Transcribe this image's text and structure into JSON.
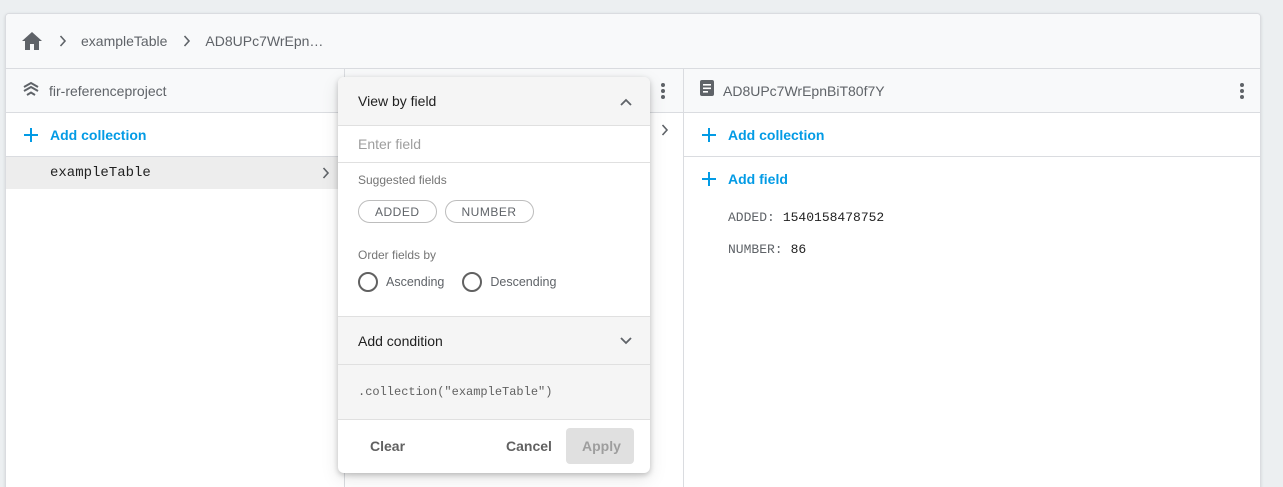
{
  "breadcrumb": {
    "items": [
      "exampleTable",
      "AD8UPc7WrEpn…"
    ]
  },
  "panels": {
    "root": {
      "title": "fir-referenceproject",
      "add_label": "Add collection",
      "items": [
        "exampleTable"
      ]
    },
    "document": {
      "title": "AD8UPc7WrEpnBiT80f7Y",
      "add_collection_label": "Add collection",
      "add_field_label": "Add field",
      "fields": [
        {
          "key": "ADDED:",
          "value": "1540158478752"
        },
        {
          "key": "NUMBER:",
          "value": "86"
        }
      ]
    }
  },
  "filter": {
    "header": "View by field",
    "input_placeholder": "Enter field",
    "suggested_label": "Suggested fields",
    "suggested": [
      "ADDED",
      "NUMBER"
    ],
    "order_label": "Order fields by",
    "order_options": [
      "Ascending",
      "Descending"
    ],
    "condition_label": "Add condition",
    "query": ".collection(\"exampleTable\")",
    "buttons": {
      "clear": "Clear",
      "cancel": "Cancel",
      "apply": "Apply"
    }
  },
  "colors": {
    "accent": "#039be5",
    "background": "#eceff1",
    "selected_row": "#ededed"
  },
  "icons": [
    "home-icon",
    "chevron-right-icon",
    "firestore-icon",
    "more-vert-icon",
    "plus-icon",
    "document-icon",
    "chevron-up-icon",
    "chevron-down-icon"
  ]
}
